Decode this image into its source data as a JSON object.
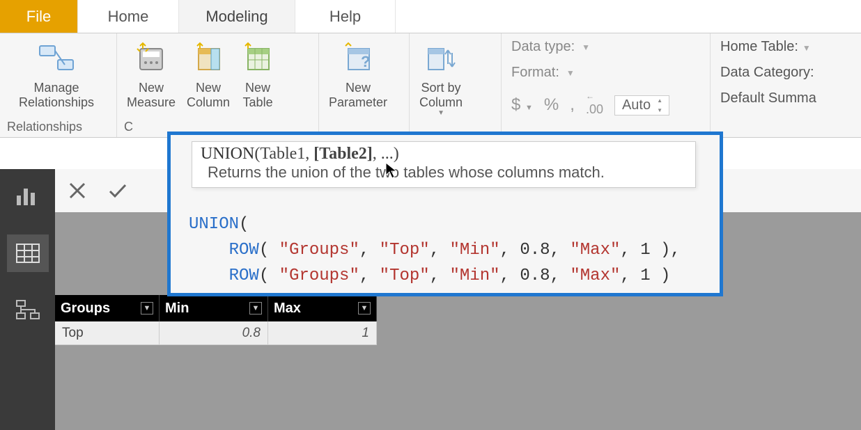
{
  "tabs": {
    "file": "File",
    "home": "Home",
    "modeling": "Modeling",
    "help": "Help"
  },
  "ribbon": {
    "relationships": {
      "manage": "Manage\nRelationships",
      "group_label": "Relationships"
    },
    "calculations": {
      "new_measure": "New\nMeasure",
      "new_column": "New\nColumn",
      "new_table": "New\nTable",
      "group_label_prefix": "C"
    },
    "whatif": {
      "new_parameter": "New\nParameter"
    },
    "sort": {
      "sort_by_column": "Sort by\nColumn"
    },
    "formatting": {
      "data_type": "Data type:",
      "format": "Format:",
      "dollar": "$",
      "percent": "%",
      "comma": ",",
      "decimal": ".00",
      "auto": "Auto"
    },
    "properties": {
      "home_table": "Home Table:",
      "data_category": "Data Category:",
      "default_summa": "Default Summa"
    }
  },
  "formula": {
    "tooltip_signature_fn": "UNION",
    "tooltip_param1": "Table1",
    "tooltip_param2_current": "[Table2]",
    "tooltip_rest": ", ...)",
    "tooltip_desc": "Returns the union of the two tables whose columns match.",
    "code": {
      "union": "UNION",
      "row": "ROW",
      "groups": "\"Groups\"",
      "top": "\"Top\"",
      "min": "\"Min\"",
      "max": "\"Max\"",
      "v08": "0.8",
      "v1": "1"
    }
  },
  "table": {
    "columns": [
      "Groups",
      "Min",
      "Max"
    ],
    "rows": [
      {
        "groups": "Top",
        "min": "0.8",
        "max": "1"
      }
    ]
  }
}
